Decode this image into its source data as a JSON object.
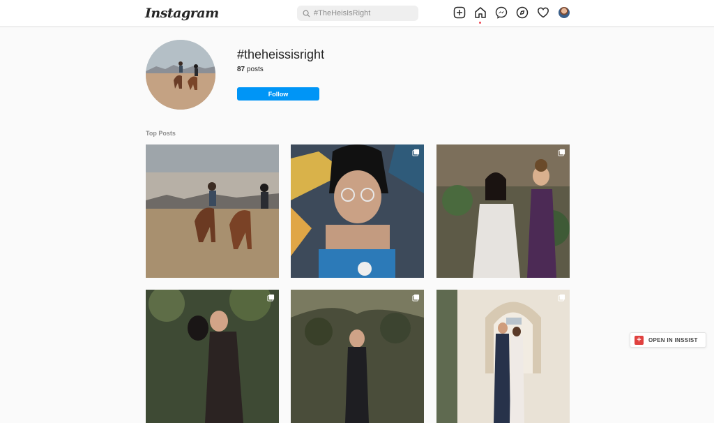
{
  "header": {
    "logo_text": "Instagram",
    "search_placeholder": "#TheHeisIsRight",
    "nav_icons": [
      "new-post-icon",
      "home-icon",
      "messenger-icon",
      "explore-icon",
      "activity-heart-icon",
      "profile-avatar"
    ]
  },
  "tag": {
    "name": "#theheissisright",
    "posts_count": "87",
    "posts_label": "posts",
    "follow_label": "Follow"
  },
  "section": {
    "top_posts_label": "Top Posts"
  },
  "extension": {
    "label": "OPEN IN INSSIST"
  },
  "colors": {
    "accent": "#0095f6",
    "notification_dot": "#ed4956",
    "background": "#fafafa"
  }
}
